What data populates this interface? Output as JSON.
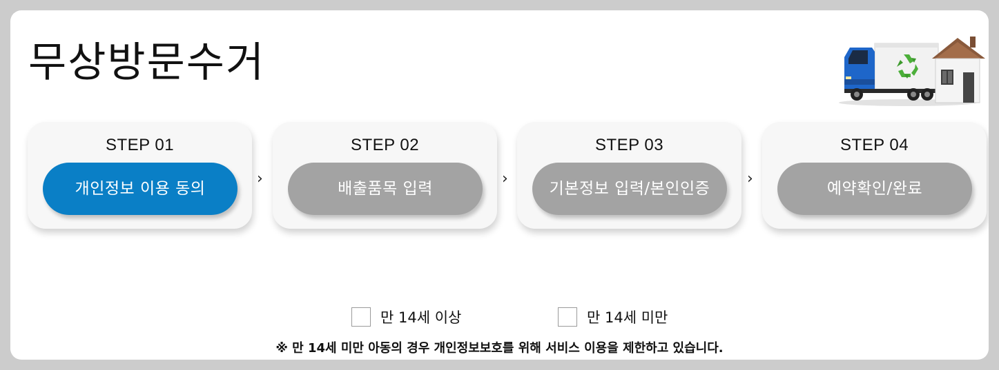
{
  "page": {
    "title": "무상방문수거"
  },
  "steps": [
    {
      "label": "STEP 01",
      "button": "개인정보 이용 동의",
      "active": true
    },
    {
      "label": "STEP 02",
      "button": "배출품목 입력",
      "active": false
    },
    {
      "label": "STEP 03",
      "button": "기본정보 입력/본인인증",
      "active": false
    },
    {
      "label": "STEP 04",
      "button": "예약확인/완료",
      "active": false
    }
  ],
  "step_separator": "›",
  "age_options": [
    {
      "label": "만 14세 이상",
      "checked": false
    },
    {
      "label": "만 14세 미만",
      "checked": false
    }
  ],
  "notice": "※ 만 14세 미만 아동의 경우 개인정보보호를 위해 서비스 이용을 제한하고 있습니다.",
  "colors": {
    "active_step": "#0a7fc6",
    "inactive_step": "#a3a3a3",
    "background": "#cccccc",
    "panel": "#ffffff"
  },
  "icons": {
    "illustration": "recycling-truck-and-house-illustration",
    "recycle": "recycle-icon"
  }
}
